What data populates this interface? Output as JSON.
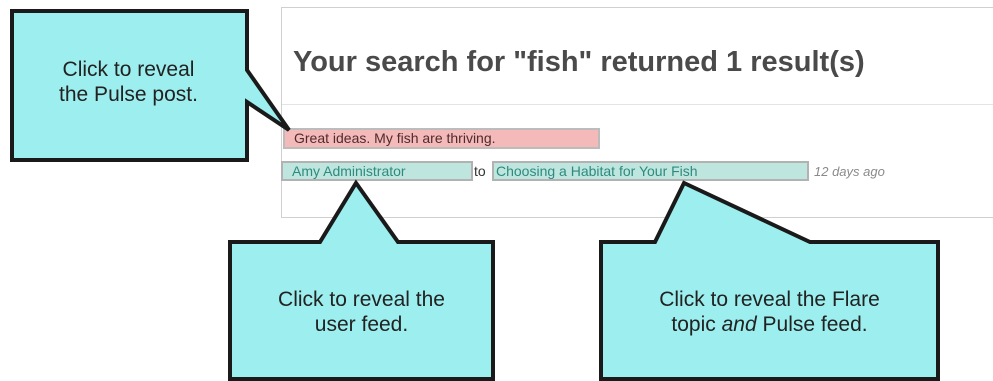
{
  "search_results": {
    "heading": "Your search for \"fish\" returned 1 result(s)",
    "result": {
      "post_text": "Great ideas. My fish are thriving.",
      "author": "Amy Administrator",
      "to_word": "to",
      "topic": "Choosing a Habitat for Your Fish",
      "time_ago": "12 days ago"
    }
  },
  "callouts": {
    "post": {
      "line1": "Click to reveal",
      "line2": "the Pulse post."
    },
    "user": {
      "line1": "Click to reveal the",
      "line2": "user feed."
    },
    "topic": {
      "line1": "Click to reveal the Flare",
      "line2_before": "topic ",
      "line2_em": "and",
      "line2_after": " Pulse feed."
    }
  },
  "colors": {
    "callout_fill": "#9deeee",
    "callout_border": "#1a1a1a",
    "post_highlight": "#f4b9b9",
    "link_highlight": "#bfe6de"
  }
}
